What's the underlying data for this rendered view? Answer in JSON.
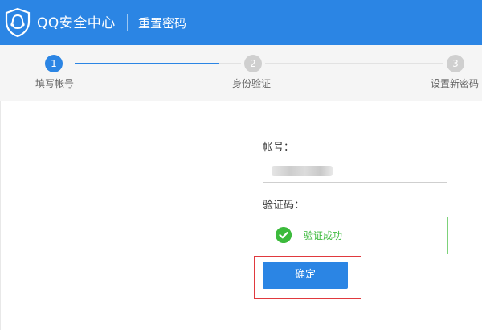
{
  "colors": {
    "brand_blue": "#2b85e4",
    "success_green": "#3cba3c",
    "highlight_red": "#e0393e"
  },
  "header": {
    "brand": "QQ安全中心",
    "subtitle": "重置密码"
  },
  "steps": [
    {
      "number": "1",
      "label": "填写帐号",
      "state": "active"
    },
    {
      "number": "2",
      "label": "身份验证",
      "state": "pending"
    },
    {
      "number": "3",
      "label": "设置新密码",
      "state": "pending"
    }
  ],
  "form": {
    "account_label": "帐号：",
    "captcha_label": "验证码：",
    "verify_status": "验证成功",
    "confirm_label": "确定"
  }
}
